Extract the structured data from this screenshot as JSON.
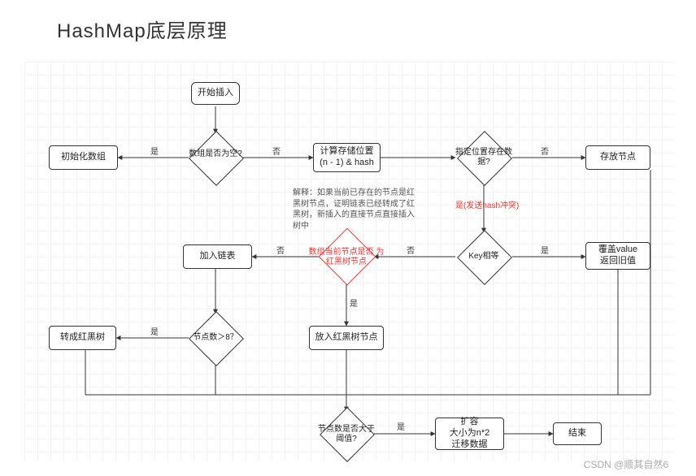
{
  "title": "HashMap底层原理",
  "watermark": "CSDN @顺其自然6",
  "nodes": {
    "start": "开始插入",
    "init_array": "初始化数组",
    "calc_pos": "计算存储位置\n(n - 1) & hash",
    "store_node": "存放节点",
    "override_value": "覆盖value\n返回旧值",
    "add_list": "加入链表",
    "put_rbtree": "放入红黑树节点",
    "to_rbtree": "转成红黑树",
    "resize": "扩容\n大小为n*2\n迁移数据",
    "end": "结束"
  },
  "decisions": {
    "is_empty": "数组是否为空?",
    "pos_has_data": "指定位置存在数\n据?",
    "key_equal": "Key相等",
    "is_rbtree": "数组当前节点是否\n为红黑树节点",
    "gt8": "节点数＞8？",
    "gt_threshold": "节点数是否大于\n阈值?"
  },
  "edges": {
    "yes": "是",
    "no": "否",
    "yes_hash": "是(发送hash冲突)"
  },
  "annotation": "解释：如果当前已存在的节点是红黑树节点，证明链表已经转成了红黑树，新插入的直接节点直接插入树中"
}
